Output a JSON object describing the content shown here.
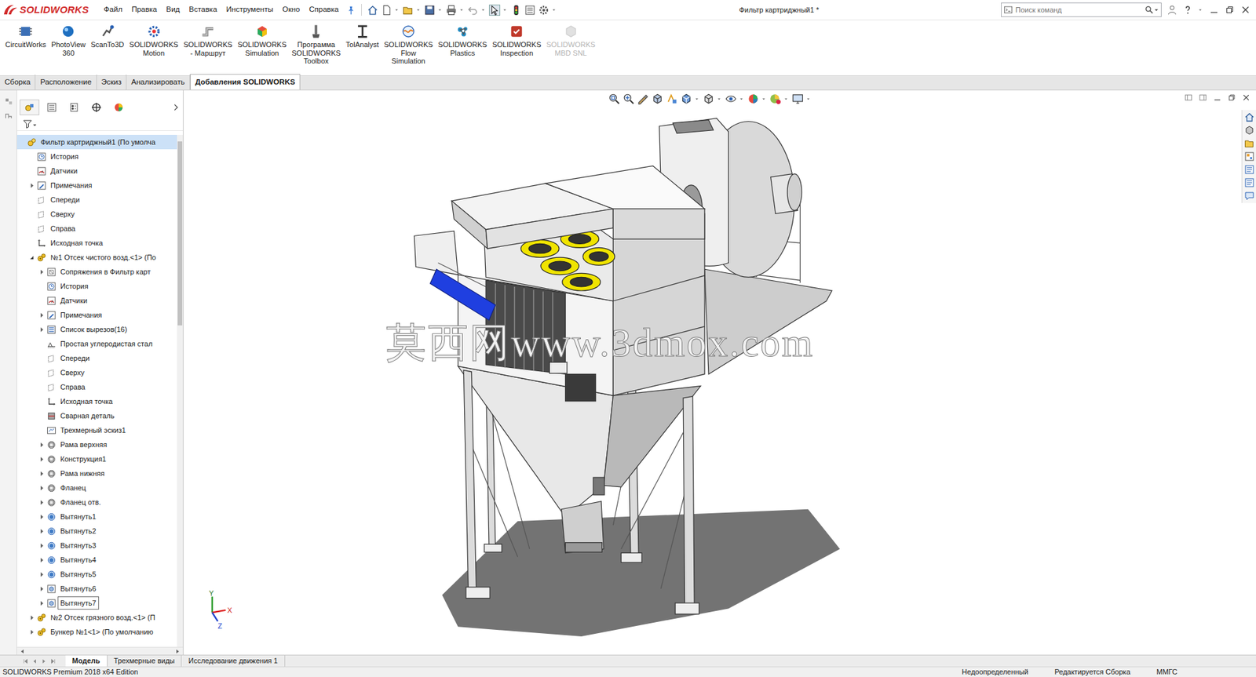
{
  "app": {
    "logo": "SOLIDWORKS",
    "title": "Фильтр картриджный1 *"
  },
  "menu": [
    "Файл",
    "Правка",
    "Вид",
    "Вставка",
    "Инструменты",
    "Окно",
    "Справка"
  ],
  "search": {
    "placeholder": "Поиск команд"
  },
  "ribbon": [
    {
      "label": "CircuitWorks",
      "disabled": false
    },
    {
      "label": "PhotoView\n360",
      "disabled": false
    },
    {
      "label": "ScanTo3D",
      "disabled": false
    },
    {
      "label": "SOLIDWORKS\nMotion",
      "disabled": false
    },
    {
      "label": "SOLIDWORKS\n- Маршрут",
      "disabled": false
    },
    {
      "label": "SOLIDWORKS\nSimulation",
      "disabled": false
    },
    {
      "label": "Программа\nSOLIDWORKS\nToolbox",
      "disabled": false
    },
    {
      "label": "TolAnalyst",
      "disabled": false
    },
    {
      "label": "SOLIDWORKS\nFlow\nSimulation",
      "disabled": false
    },
    {
      "label": "SOLIDWORKS\nPlastics",
      "disabled": false
    },
    {
      "label": "SOLIDWORKS\nInspection",
      "disabled": false
    },
    {
      "label": "SOLIDWORKS\nMBD SNL",
      "disabled": true
    }
  ],
  "tabs": [
    {
      "label": "Сборка",
      "selected": false
    },
    {
      "label": "Расположение",
      "selected": false
    },
    {
      "label": "Эскиз",
      "selected": false
    },
    {
      "label": "Анализировать",
      "selected": false
    },
    {
      "label": "Добавления SOLIDWORKS",
      "selected": true
    }
  ],
  "tree_scrollbar": {
    "level": 0.36
  },
  "tree": {
    "label": "Фильтр картриджный1 (По умолча",
    "kind": "assembly",
    "expander": "none",
    "selected": true,
    "focused": false,
    "children": [
      {
        "label": "История",
        "kind": "history",
        "expander": "none",
        "selected": false,
        "focused": false
      },
      {
        "label": "Датчики",
        "kind": "sensor",
        "expander": "none",
        "selected": false,
        "focused": false
      },
      {
        "label": "Примечания",
        "kind": "notes",
        "expander": "collapsed",
        "selected": false,
        "focused": false
      },
      {
        "label": "Спереди",
        "kind": "plane",
        "expander": "none",
        "selected": false,
        "focused": false
      },
      {
        "label": "Сверху",
        "kind": "plane",
        "expander": "none",
        "selected": false,
        "focused": false
      },
      {
        "label": "Справа",
        "kind": "plane",
        "expander": "none",
        "selected": false,
        "focused": false
      },
      {
        "label": "Исходная точка",
        "kind": "origin",
        "expander": "none",
        "selected": false,
        "focused": false
      },
      {
        "label": "№1 Отсек чистого возд.<1> (По",
        "kind": "component",
        "expander": "expanded",
        "selected": false,
        "focused": false,
        "children": [
          {
            "label": "Сопряжения в Фильтр карт",
            "kind": "mates",
            "expander": "collapsed",
            "selected": false,
            "focused": false
          },
          {
            "label": "История",
            "kind": "history",
            "expander": "none",
            "selected": false,
            "focused": false
          },
          {
            "label": "Датчики",
            "kind": "sensor",
            "expander": "none",
            "selected": false,
            "focused": false
          },
          {
            "label": "Примечания",
            "kind": "notes",
            "expander": "collapsed",
            "selected": false,
            "focused": false
          },
          {
            "label": "Список вырезов(16)",
            "kind": "cutlist",
            "expander": "collapsed",
            "selected": false,
            "focused": false
          },
          {
            "label": "Простая углеродистая стал",
            "kind": "material",
            "expander": "none",
            "selected": false,
            "focused": false
          },
          {
            "label": "Спереди",
            "kind": "plane",
            "expander": "none",
            "selected": false,
            "focused": false
          },
          {
            "label": "Сверху",
            "kind": "plane",
            "expander": "none",
            "selected": false,
            "focused": false
          },
          {
            "label": "Справа",
            "kind": "plane",
            "expander": "none",
            "selected": false,
            "focused": false
          },
          {
            "label": "Исходная точка",
            "kind": "origin",
            "expander": "none",
            "selected": false,
            "focused": false
          },
          {
            "label": "Сварная деталь",
            "kind": "weldment",
            "expander": "none",
            "selected": false,
            "focused": false
          },
          {
            "label": "Трехмерный эскиз1",
            "kind": "sketch3d",
            "expander": "none",
            "selected": false,
            "focused": false
          },
          {
            "label": "Рама верхняя",
            "kind": "structure",
            "expander": "collapsed",
            "selected": false,
            "focused": false
          },
          {
            "label": "Конструкция1",
            "kind": "structure",
            "expander": "collapsed",
            "selected": false,
            "focused": false
          },
          {
            "label": "Рама нижняя",
            "kind": "structure",
            "expander": "collapsed",
            "selected": false,
            "focused": false
          },
          {
            "label": "Фланец",
            "kind": "structure",
            "expander": "collapsed",
            "selected": false,
            "focused": false
          },
          {
            "label": "Фланец отв.",
            "kind": "structure",
            "expander": "collapsed",
            "selected": false,
            "focused": false
          },
          {
            "label": "Вытянуть1",
            "kind": "extrude",
            "expander": "collapsed",
            "selected": false,
            "focused": false
          },
          {
            "label": "Вытянуть2",
            "kind": "extrude",
            "expander": "collapsed",
            "selected": false,
            "focused": false
          },
          {
            "label": "Вытянуть3",
            "kind": "extrude",
            "expander": "collapsed",
            "selected": false,
            "focused": false
          },
          {
            "label": "Вытянуть4",
            "kind": "extrude",
            "expander": "collapsed",
            "selected": false,
            "focused": false
          },
          {
            "label": "Вытянуть5",
            "kind": "extrude",
            "expander": "collapsed",
            "selected": false,
            "focused": false
          },
          {
            "label": "Вытянуть6",
            "kind": "cut",
            "expander": "collapsed",
            "selected": false,
            "focused": false
          },
          {
            "label": "Вытянуть7",
            "kind": "cut",
            "expander": "collapsed",
            "selected": false,
            "focused": true
          }
        ]
      },
      {
        "label": "№2 Отсек грязного возд.<1> (П",
        "kind": "component",
        "expander": "collapsed",
        "selected": false,
        "focused": false
      },
      {
        "label": "Бункер №1<1> (По умолчанию",
        "kind": "component",
        "expander": "collapsed",
        "selected": false,
        "focused": false
      }
    ]
  },
  "watermark": "莫西网www.3dmox.com",
  "triad": {
    "x": "X",
    "y": "Y",
    "z": "Z"
  },
  "bottom_tabs": [
    {
      "label": "Модель",
      "selected": true
    },
    {
      "label": "Трехмерные виды",
      "selected": false
    },
    {
      "label": "Исследование движения 1",
      "selected": false
    }
  ],
  "status_bar": {
    "left": "SOLIDWORKS Premium 2018 x64 Edition",
    "right": [
      "Недоопределенный",
      "Редактируется Сборка",
      "ММГС"
    ]
  }
}
